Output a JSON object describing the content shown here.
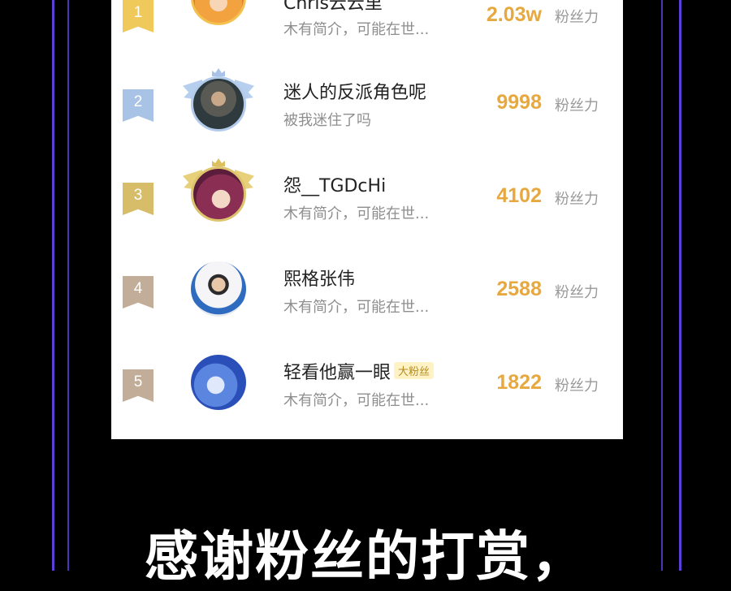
{
  "ranking": {
    "unit_label": "粉丝力",
    "rows": [
      {
        "rank": "1",
        "name": "Chris云云里",
        "intro": "木有简介，可能在世...",
        "score": "2.03w",
        "flag_color": "#f0c95b",
        "frame": "gold",
        "avatar_color": "#f2a23e"
      },
      {
        "rank": "2",
        "name": "迷人的反派角色呢",
        "intro": "被我迷住了吗",
        "score": "9998",
        "flag_color": "#a9c3e6",
        "frame": "silver",
        "avatar_color": "#3c4b4f"
      },
      {
        "rank": "3",
        "name": "怨__TGDcHi",
        "intro": "木有简介，可能在世...",
        "score": "4102",
        "flag_color": "#d7bd6a",
        "frame": "bronze",
        "avatar_color": "#8a2e54"
      },
      {
        "rank": "4",
        "name": "熙格张伟",
        "intro": "木有简介，可能在世...",
        "score": "2588",
        "flag_color": "#c2ad98",
        "frame": "none",
        "avatar_color": "#dfe3ea"
      },
      {
        "rank": "5",
        "name": "轻看他赢一眼",
        "badge": "大粉丝",
        "intro": "木有简介，可能在世...",
        "score": "1822",
        "flag_color": "#c2ad98",
        "frame": "none",
        "avatar_color": "#3e6fd6"
      }
    ]
  },
  "caption": "感谢粉丝的打赏，",
  "colors": {
    "frame_purple": "#5b3fd6",
    "score_gold": "#e7a93f"
  }
}
